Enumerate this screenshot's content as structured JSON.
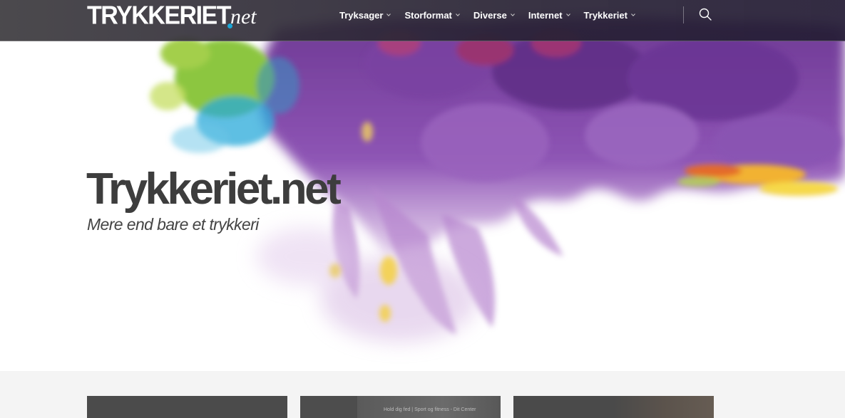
{
  "header": {
    "logo": {
      "main": "TRYKKERIET",
      "suffix": "net"
    },
    "nav": [
      {
        "label": "Tryksager",
        "icon": "chevron-down-icon"
      },
      {
        "label": "Storformat",
        "icon": "chevron-down-icon"
      },
      {
        "label": "Diverse",
        "icon": "chevron-down-icon"
      },
      {
        "label": "Internet",
        "icon": "chevron-down-icon"
      },
      {
        "label": "Trykkeriet",
        "icon": "chevron-down-icon"
      }
    ],
    "search_icon": "search-icon"
  },
  "hero": {
    "title": "Trykkeriet.net",
    "subtitle": "Mere end bare et trykkeri"
  },
  "cards": [
    {
      "caption": ""
    },
    {
      "caption": "Hold dig fed | Sport og fitness - Dit Center"
    },
    {
      "caption": ""
    }
  ],
  "colors": {
    "header_bg": "#3a3540",
    "ink_purple": "#8b4fa8",
    "ink_green": "#8cc63f",
    "ink_blue": "#2aa9d9",
    "ink_yellow": "#f4d03f",
    "logo_dot": "#1aa6d6",
    "title_text": "#3d3d3d"
  }
}
